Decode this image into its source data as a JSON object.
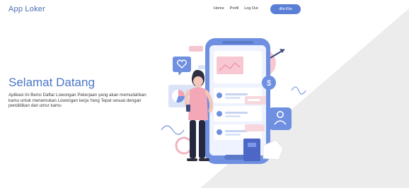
{
  "brand": "App Loker",
  "nav": {
    "links": [
      "Home",
      "Profil",
      "Log Out"
    ],
    "cta": "dfta Kita"
  },
  "hero": {
    "title": "Selamat Datang",
    "description": "Aplikasi Ini Berisi Daftar Lowongan Pekerjaan yang akan memudahkan kamu untuk menemukan Lowongan kerja Yang Tepat sesuai dengan pendidikan dan umur kamu"
  },
  "colors": {
    "brand": "#4a6bb0",
    "accent": "#5a7fd6",
    "title": "#4a76c8",
    "background_shape": "#ececec",
    "pink_accent": "#f2a3b3"
  },
  "icons": [
    "heart-icon",
    "dollar-icon",
    "user-icon",
    "pie-chart-icon",
    "target-icon"
  ]
}
